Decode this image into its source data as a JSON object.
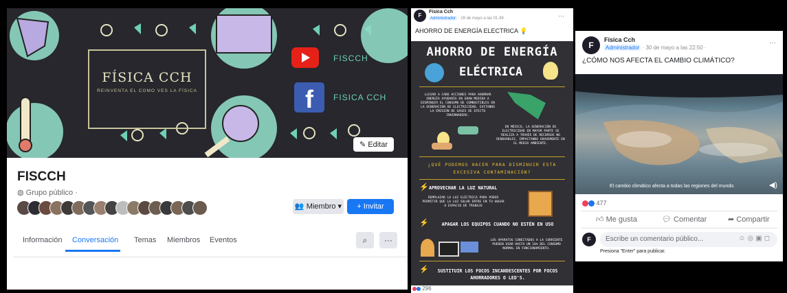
{
  "group": {
    "cover_title": "FÍSICA CCH",
    "cover_subtitle": "REINVENTA EL COMO VES LA FÍSICA",
    "youtube_label": "FISCCH",
    "facebook_label": "FISICA CCH",
    "edit_button": "Editar",
    "name": "FISCCH",
    "privacy": "Grupo público ·",
    "member_button": "Miembro",
    "invite_button": "+ Invitar",
    "tabs": [
      "Información",
      "Conversación",
      "Temas",
      "Miembros",
      "Eventos"
    ],
    "active_tab": "Conversación",
    "more_label": "···"
  },
  "post1": {
    "author": "Física Cch",
    "role": "Administrador",
    "time": "· 28 de mayo a las 01:49 ·",
    "text": "AHORRO DE ENERGÍA ELECTRICA",
    "menu": "···",
    "infographic": {
      "title_line1": "AHORRO DE ENERGÍA",
      "title_line2": "ELÉCTRICA",
      "intro": "LLEVAR A CABO ACCIONES PARA AHORRAR ENERGÍA AYUDARÍA EN GRAN MEDIDA A DISMINUIR EL CONSUMO DE COMBUSTIBLES EN LA GENERACIÓN DE ELECTRICIDAD, EVITANDO LA EMISIÓN DE GASES DE EFECTO INVERNADERO.",
      "mexico": "EN MÉXICO, LA GENERACIÓN DE ELECTRICIDAD EN MAYOR PARTE SE REALIZA A TRAVÉS DE RECURSOS NO RENOVABLES, IMPACTANDO GRAVEMENTE EN EL MEDIO AMBIENTE.",
      "question": "¿QUÉ PODEMOS HACER PARA DISMINUIR ESTA EXCESIVA CONTAMINACIÓN?",
      "item1": "APROVECHAR LA LUZ NATURAL",
      "item1_desc": "REMPLAZAR LA LUZ ELÉCTRICA PARA PODER PERMITIR QUE LA LUZ SOLAR ENTRE EN TU HOGAR U ESPACIO DE TRABAJO",
      "item2": "APAGAR LOS EQUIPOS CUANDO NO ESTÉN EN USO",
      "item2_desc": "LOS APARATOS CONECTADOS A LA CORRIENTE PUEDEN USAR HASTA UN 10% DEL CONSUMO NORMAL EN FUNCIONAMIENTO.",
      "item3": "SUSTITUIR LOS FOCOS INCANDESCENTES POR FOCOS AHORRADORES O LED'S."
    },
    "reaction_count": "296"
  },
  "post2": {
    "author": "Física Cch",
    "role": "Administrador",
    "time": "· 30 de mayo a las 22:50 ·",
    "text": "¿CÓMO NOS AFECTA EL CAMBIO CLIMÁTICO?",
    "menu": "···",
    "video_caption": "El cambio climático afecta a todas las regiones del mundo.",
    "reaction_count": "477",
    "like": "Me gusta",
    "comment": "Comentar",
    "share": "Compartir",
    "comment_placeholder": "Escribe un comentario público...",
    "press_enter": "Presiona \"Enter\" para publicar."
  },
  "colors": {
    "accent": "#1877f2",
    "cover_bg": "#27272d",
    "teal": "#6fd0b6",
    "infographic_bg": "#303035",
    "gold": "#f1c232"
  }
}
